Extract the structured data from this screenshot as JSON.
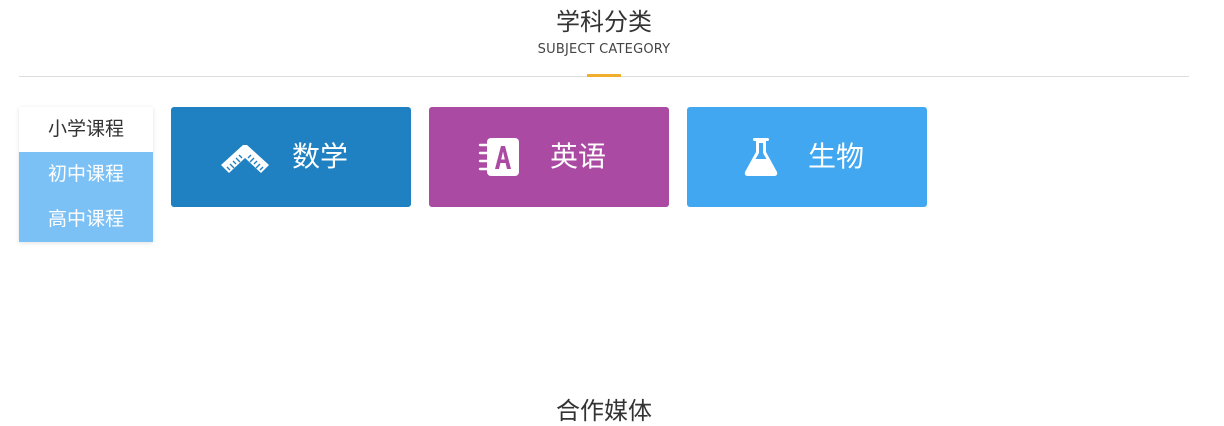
{
  "subject_section": {
    "title": "学科分类",
    "subtitle": "SUBJECT CATEGORY",
    "accent_color": "#f0ad2e"
  },
  "level_tabs": [
    {
      "label": "小学课程",
      "active": true
    },
    {
      "label": "初中课程",
      "active": false
    },
    {
      "label": "高中课程",
      "active": false
    }
  ],
  "subjects": [
    {
      "label": "数学",
      "icon": "ruler-icon",
      "color": "#1f81c1"
    },
    {
      "label": "英语",
      "icon": "notebook-letter-a-icon",
      "color": "#ab4aa2"
    },
    {
      "label": "生物",
      "icon": "flask-icon",
      "color": "#41a7f0"
    }
  ],
  "partner_section": {
    "title": "合作媒体"
  }
}
